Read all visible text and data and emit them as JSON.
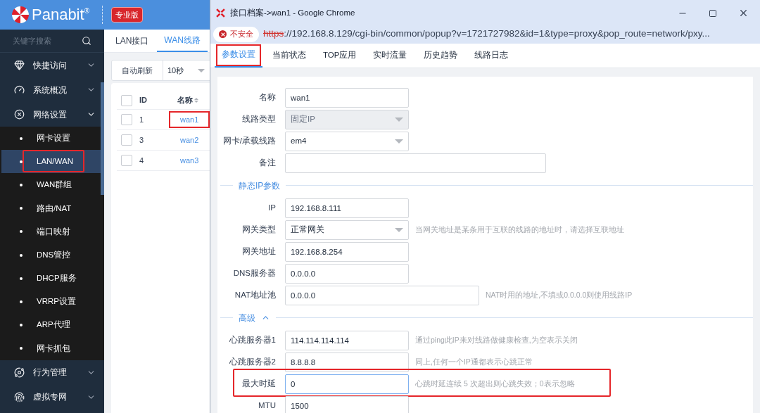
{
  "app": {
    "brand": "Panabit",
    "brand_mark": "®",
    "edition": "专业版"
  },
  "sidebar": {
    "search_placeholder": "关键字搜索",
    "items": [
      {
        "label": "快捷访问",
        "expanded": false
      },
      {
        "label": "系统概况",
        "expanded": false
      },
      {
        "label": "网络设置",
        "expanded": true,
        "children": [
          {
            "label": "网卡设置",
            "selected": false,
            "highlighted": false
          },
          {
            "label": "LAN/WAN",
            "selected": true,
            "highlighted": true
          },
          {
            "label": "WAN群组",
            "selected": false,
            "highlighted": false
          },
          {
            "label": "路由/NAT",
            "selected": false,
            "highlighted": false
          },
          {
            "label": "端口映射",
            "selected": false,
            "highlighted": false
          },
          {
            "label": "DNS管控",
            "selected": false,
            "highlighted": false
          },
          {
            "label": "DHCP服务",
            "selected": false,
            "highlighted": false
          },
          {
            "label": "VRRP设置",
            "selected": false,
            "highlighted": false
          },
          {
            "label": "ARP代理",
            "selected": false,
            "highlighted": false
          },
          {
            "label": "网卡抓包",
            "selected": false,
            "highlighted": false
          }
        ]
      },
      {
        "label": "行为管理",
        "expanded": false
      },
      {
        "label": "虚拟专网",
        "expanded": false
      }
    ]
  },
  "main": {
    "tabs": [
      {
        "label": "LAN接口",
        "selected": false
      },
      {
        "label": "WAN线路",
        "selected": true
      }
    ],
    "toolbar": {
      "label": "自动刷新",
      "interval": "10秒"
    },
    "table": {
      "columns": [
        "ID",
        "名称"
      ],
      "all_checked": false,
      "rows": [
        {
          "checked": false,
          "id": "1",
          "name": "wan1",
          "highlighted": true
        },
        {
          "checked": false,
          "id": "3",
          "name": "wan2",
          "highlighted": false
        },
        {
          "checked": false,
          "id": "4",
          "name": "wan3",
          "highlighted": false
        }
      ]
    }
  },
  "popup": {
    "title": "接口档案->wan1 - Google Chrome",
    "security": "不安全",
    "url_scheme": "https",
    "url_rest": "://192.168.8.129/cgi-bin/common/popup?v=1721727982&id=1&type=proxy&pop_route=network/pxy...",
    "tabs": [
      {
        "label": "参数设置",
        "selected": true,
        "highlighted": true
      },
      {
        "label": "当前状态",
        "selected": false,
        "highlighted": false
      },
      {
        "label": "TOP应用",
        "selected": false,
        "highlighted": false
      },
      {
        "label": "实时流量",
        "selected": false,
        "highlighted": false
      },
      {
        "label": "历史趋势",
        "selected": false,
        "highlighted": false
      },
      {
        "label": "线路日志",
        "selected": false,
        "highlighted": false
      }
    ],
    "form": [
      {
        "kind": "text-field",
        "label": "名称",
        "value": "wan1",
        "disabled": false,
        "focused": false,
        "highlighted": false
      },
      {
        "kind": "select-field",
        "label": "线路类型",
        "value": "固定IP",
        "disabled": true,
        "focused": false,
        "highlighted": false
      },
      {
        "kind": "select-field",
        "label": "网卡/承载线路",
        "value": "em4",
        "disabled": false,
        "focused": false,
        "highlighted": false
      },
      {
        "kind": "wide-field",
        "label": "备注",
        "disabled": false,
        "focused": false,
        "highlighted": false
      },
      {
        "kind": "section",
        "title": "静态IP参数"
      },
      {
        "kind": "text-field",
        "label": "IP",
        "value": "192.168.8.111",
        "disabled": false,
        "focused": false,
        "highlighted": false
      },
      {
        "kind": "select-field",
        "label": "网关类型",
        "value": "正常网关",
        "hint": "当网关地址是某条用于互联的线路的地址时，请选择互联地址",
        "disabled": false,
        "focused": false,
        "highlighted": false
      },
      {
        "kind": "text-field",
        "label": "网关地址",
        "value": "192.168.8.254",
        "disabled": false,
        "focused": false,
        "highlighted": false
      },
      {
        "kind": "text-field",
        "label": "DNS服务器",
        "value": "0.0.0.0",
        "disabled": false,
        "focused": false,
        "highlighted": false
      },
      {
        "kind": "medium-field",
        "label": "NAT地址池",
        "value": "0.0.0.0",
        "hint": "NAT时用的地址,不填或0.0.0.0则使用线路IP",
        "disabled": false,
        "focused": false,
        "highlighted": false
      },
      {
        "kind": "section",
        "title": "高级",
        "expanded": true
      },
      {
        "kind": "text-field",
        "label": "心跳服务器1",
        "value": "114.114.114.114",
        "hint": "通过ping此IP来对线路做健康检查,为空表示关闭",
        "disabled": false,
        "focused": false,
        "highlighted": false
      },
      {
        "kind": "text-field",
        "label": "心跳服务器2",
        "value": "8.8.8.8",
        "hint": "同上,任何一个IP通都表示心跳正常",
        "disabled": false,
        "focused": false,
        "highlighted": false
      },
      {
        "kind": "text-field",
        "label": "最大时延",
        "value": "0",
        "hint": "心跳时延连续 5 次超出则心跳失效；0表示忽略",
        "disabled": false,
        "focused": true,
        "highlighted": true
      },
      {
        "kind": "text-field",
        "label": "MTU",
        "value": "1500",
        "disabled": false,
        "focused": false,
        "highlighted": false
      }
    ]
  }
}
